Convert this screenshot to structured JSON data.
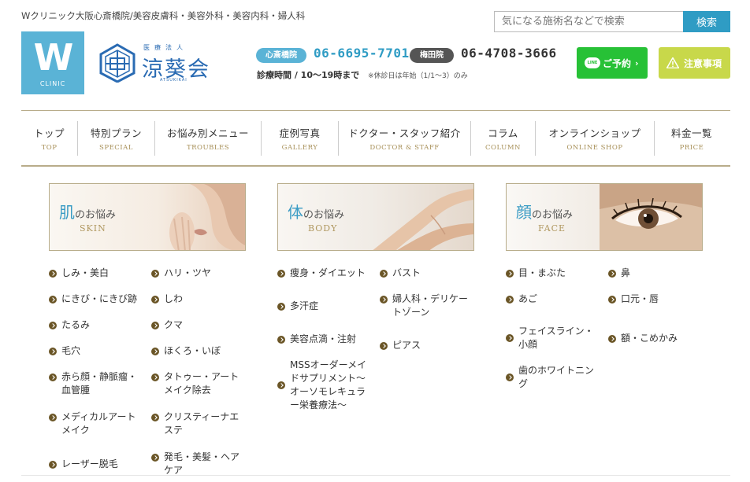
{
  "header": {
    "tagline": "Wクリニック大阪心斎橋院/美容皮膚科・美容外科・美容内科・婦人科",
    "search": {
      "placeholder": "気になる施術名などで検索",
      "button_label": "検索"
    },
    "logo": {
      "letter": "W",
      "caption": "CLINIC"
    },
    "corp_logo": {
      "sub": "医療法人",
      "main": "涼葵会",
      "roman": "ATSUKIKAI"
    },
    "phones": [
      {
        "branch": "心斎橋院",
        "number": "06-6695-7701",
        "color": "#5ab3d6"
      },
      {
        "branch": "梅田院",
        "number": "06-4708-3666",
        "color": "#555555"
      }
    ],
    "hours": "診療時間 / 10〜19時まで",
    "holiday_note": "※休診日は年始（1/1〜3）のみ",
    "reserve_button": {
      "icon_text": "LINE",
      "label": "ご予約",
      "color": "#27c136"
    },
    "caution_button": {
      "label": "注意事項",
      "color": "#c8d84a"
    }
  },
  "nav": [
    {
      "jp": "トップ",
      "en": "TOP"
    },
    {
      "jp": "特別プラン",
      "en": "SPECIAL"
    },
    {
      "jp": "お悩み別メニュー",
      "en": "TROUBLES"
    },
    {
      "jp": "症例写真",
      "en": "GALLERY"
    },
    {
      "jp": "ドクター・スタッフ紹介",
      "en": "DOCTOR & STAFF"
    },
    {
      "jp": "コラム",
      "en": "COLUMN"
    },
    {
      "jp": "オンラインショップ",
      "en": "ONLINE SHOP"
    },
    {
      "jp": "料金一覧",
      "en": "PRICE"
    }
  ],
  "categories": {
    "skin": {
      "kanji": "肌",
      "suffix": "のお悩み",
      "en": "SKIN",
      "items": [
        "しみ・美白",
        "ハリ・ツヤ",
        "にきび・にきび跡",
        "しわ",
        "たるみ",
        "クマ",
        "毛穴",
        "ほくろ・いぼ",
        "赤ら顔・静脈瘤・血管腫",
        "タトゥー・アートメイク除去",
        "メディカルアートメイク",
        "クリスティーナエステ",
        "レーザー脱毛",
        "発毛・美髪・ヘアケア"
      ]
    },
    "body": {
      "kanji": "体",
      "suffix": "のお悩み",
      "en": "BODY",
      "items": [
        "痩身・ダイエット",
        "バスト",
        "多汗症",
        "婦人科・デリケートゾーン",
        "美容点滴・注射",
        "ピアス",
        "MSSオーダーメイドサプリメント〜オーソモレキュラー栄養療法〜"
      ]
    },
    "face": {
      "kanji": "顔",
      "suffix": "のお悩み",
      "en": "FACE",
      "items": [
        "目・まぶた",
        "鼻",
        "あご",
        "口元・唇",
        "フェイスライン・小顔",
        "額・こめかみ",
        "歯のホワイトニング"
      ]
    }
  }
}
